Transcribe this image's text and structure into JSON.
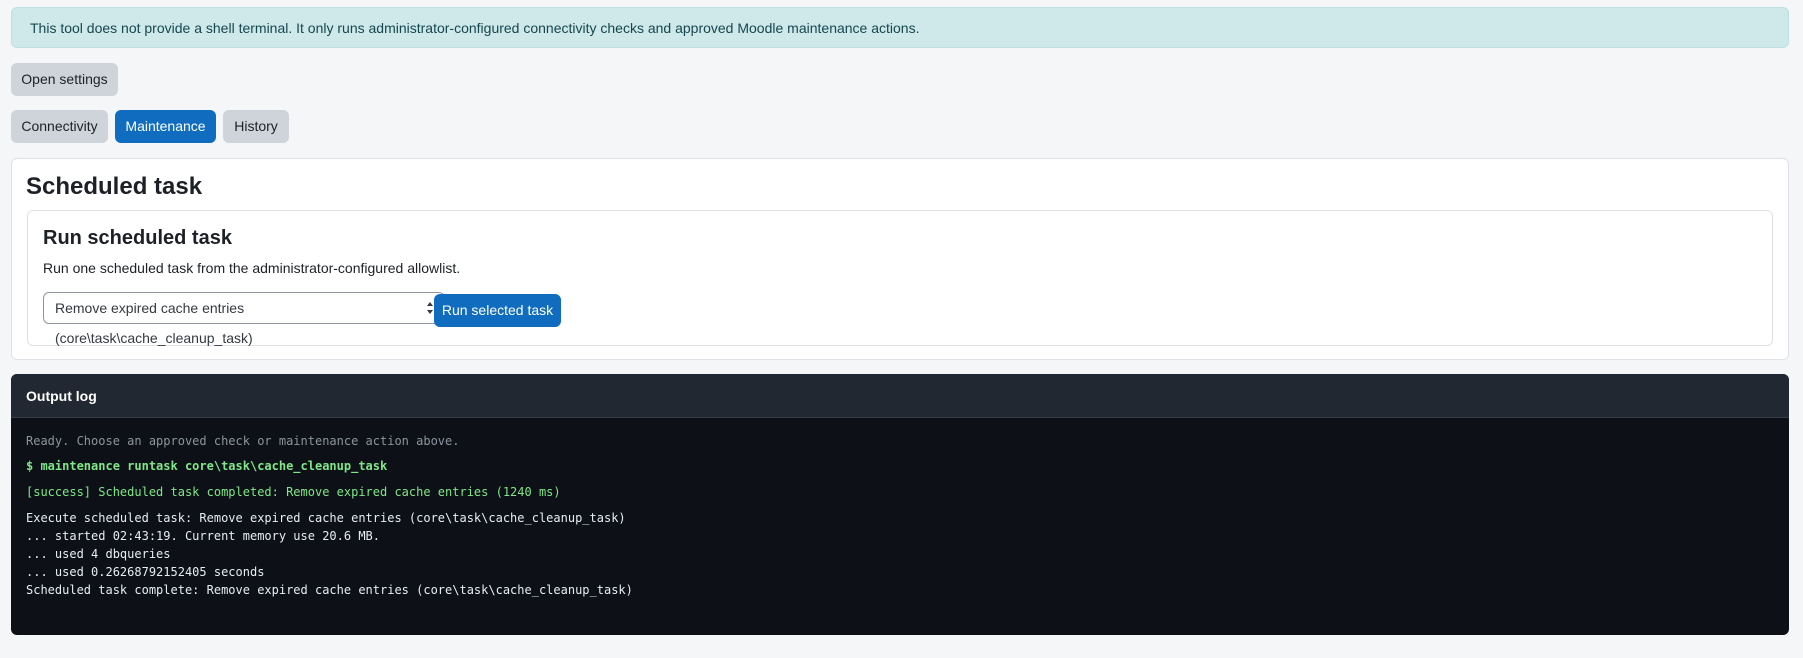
{
  "notice": {
    "text": "This tool does not provide a shell terminal. It only runs administrator-configured connectivity checks and approved Moodle maintenance actions."
  },
  "actions": {
    "open_settings_label": "Open settings"
  },
  "tabs": [
    {
      "label": "Connectivity",
      "active": false
    },
    {
      "label": "Maintenance",
      "active": true
    },
    {
      "label": "History",
      "active": false
    }
  ],
  "scheduled_task": {
    "title": "Scheduled task",
    "run_card": {
      "title": "Run scheduled task",
      "description": "Run one scheduled task from the administrator-configured allowlist.",
      "selected_task": "Remove expired cache entries (core\\task\\cache_cleanup_task)",
      "run_button_label": "Run selected task"
    }
  },
  "output_log": {
    "title": "Output log",
    "ready_line": "Ready. Choose an approved check or maintenance action above.",
    "command_line": "$ maintenance runtask core\\task\\cache_cleanup_task",
    "success_line": "[success] Scheduled task completed: Remove expired cache entries (1240 ms)",
    "details": [
      "Execute scheduled task: Remove expired cache entries (core\\task\\cache_cleanup_task)",
      "... started 02:43:19. Current memory use 20.6 MB.",
      "... used 4 dbqueries",
      "... used 0.26268792152405 seconds",
      "Scheduled task complete: Remove expired cache entries (core\\task\\cache_cleanup_task)"
    ]
  },
  "colors": {
    "primary": "#0f6cbf",
    "secondary": "#ced4da",
    "notice_bg": "#cfe8ea",
    "log_bg": "#0d1117",
    "log_success": "#7ee787"
  }
}
